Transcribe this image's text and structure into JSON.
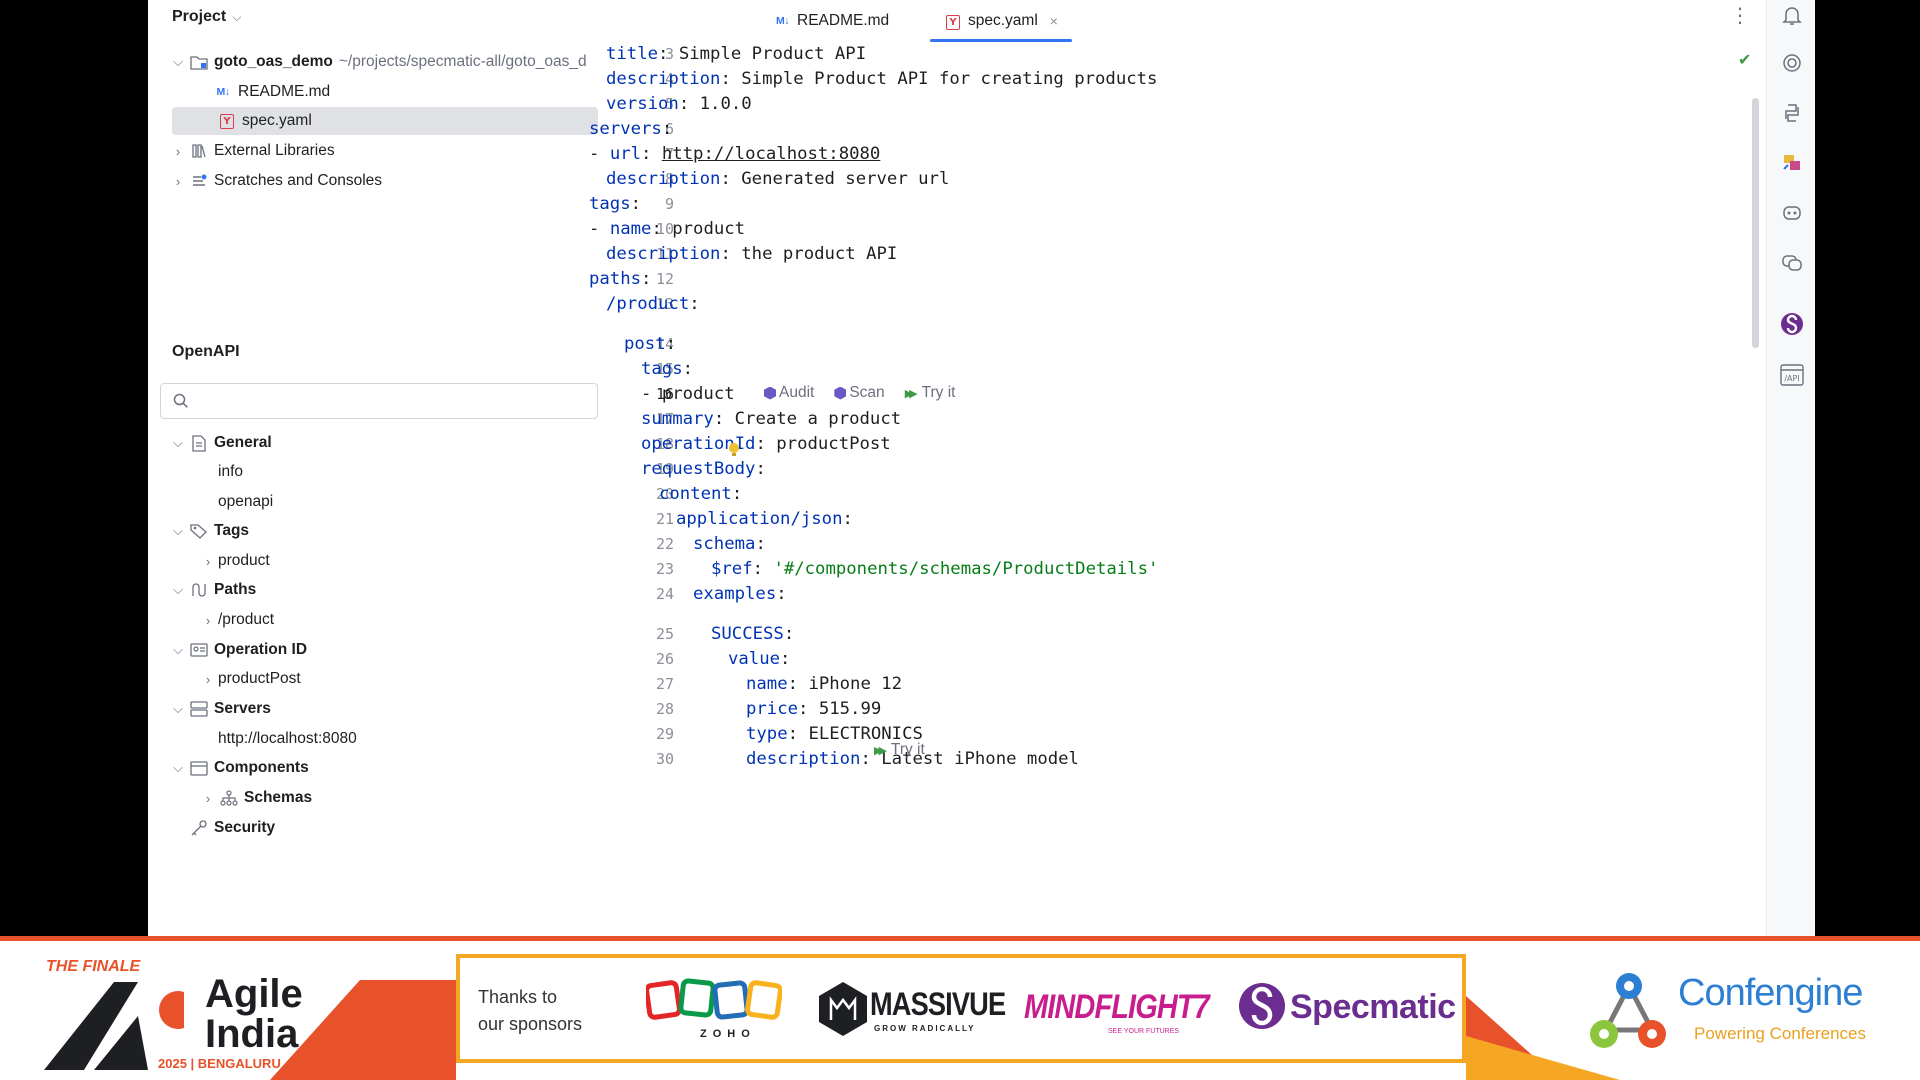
{
  "project_panel": {
    "title": "Project",
    "root": {
      "name": "goto_oas_demo",
      "path": "~/projects/specmatic-all/goto_oas_d"
    },
    "files": [
      {
        "name": "README.md",
        "icon": "markdown-icon",
        "selected": false
      },
      {
        "name": "spec.yaml",
        "icon": "yaml-icon",
        "selected": true
      }
    ],
    "external_libraries": "External Libraries",
    "scratches": "Scratches and Consoles"
  },
  "openapi_panel": {
    "title": "OpenAPI",
    "search_placeholder": "",
    "tree": {
      "general": {
        "label": "General",
        "children": [
          "info",
          "openapi"
        ]
      },
      "tags": {
        "label": "Tags",
        "children": [
          "product"
        ]
      },
      "paths": {
        "label": "Paths",
        "children": [
          "/product"
        ]
      },
      "operation_id": {
        "label": "Operation ID",
        "children": [
          "productPost"
        ]
      },
      "servers": {
        "label": "Servers",
        "children": [
          "http://localhost:8080"
        ]
      },
      "components": {
        "label": "Components",
        "children": [
          "Schemas"
        ]
      },
      "security": {
        "label": "Security"
      }
    }
  },
  "editor": {
    "tabs": [
      {
        "label": "README.md",
        "icon": "markdown-icon",
        "active": false
      },
      {
        "label": "spec.yaml",
        "icon": "yaml-icon",
        "active": true,
        "close": "×"
      }
    ],
    "current_line": 16,
    "lines": [
      {
        "n": "3",
        "key": "title",
        "val": "Simple Product API"
      },
      {
        "n": "4",
        "key": "description",
        "val": "Simple Product API for creating products"
      },
      {
        "n": "5",
        "key": "version",
        "val": "1.0.0"
      },
      {
        "n": "6",
        "key": "servers"
      },
      {
        "n": "7",
        "key": "url",
        "val": "http://localhost:8080",
        "dash": "- "
      },
      {
        "n": "8",
        "key": "description",
        "val": "Generated server url"
      },
      {
        "n": "9",
        "key": "tags"
      },
      {
        "n": "10",
        "key": "name",
        "val": "product",
        "dash": "- "
      },
      {
        "n": "11",
        "key": "description",
        "val": "the product API"
      },
      {
        "n": "12",
        "key": "paths"
      },
      {
        "n": "13",
        "key": "/product"
      },
      {
        "n": "14",
        "key": "post"
      },
      {
        "n": "15",
        "key": "tags"
      },
      {
        "n": "16",
        "val": "product",
        "dash": "- "
      },
      {
        "n": "17",
        "key": "summary",
        "val": "Create a product"
      },
      {
        "n": "18",
        "key": "operationId",
        "val": "productPost"
      },
      {
        "n": "19",
        "key": "requestBody"
      },
      {
        "n": "20",
        "key": "content"
      },
      {
        "n": "21",
        "key": "application/json"
      },
      {
        "n": "22",
        "key": "schema"
      },
      {
        "n": "23",
        "key": "$ref",
        "val": "'#/components/schemas/ProductDetails'"
      },
      {
        "n": "24",
        "key": "examples"
      },
      {
        "n": "25",
        "key": "SUCCESS"
      },
      {
        "n": "26",
        "key": "value"
      },
      {
        "n": "27",
        "key": "name",
        "val": "iPhone 12"
      },
      {
        "n": "28",
        "key": "price",
        "val": "515.99"
      },
      {
        "n": "29",
        "key": "type",
        "val": "ELECTRONICS"
      },
      {
        "n": "30",
        "key": "description",
        "val": "Latest iPhone model"
      }
    ],
    "code_lens_path": {
      "audit": "Audit",
      "scan": "Scan",
      "try_it": "Try it"
    },
    "code_lens_examples": {
      "try_it": "Try it"
    }
  },
  "right_toolbar": {
    "icons": [
      "notifications-icon",
      "ai-assistant-icon",
      "python-console-icon",
      "database-icon",
      "copilot-icon",
      "copilot-chat-icon",
      "specmatic-icon",
      "api-icon"
    ],
    "api_label": "/API"
  },
  "banner": {
    "finale": "THE FINALE",
    "agile": "Agile",
    "india": "India",
    "event_year": "2025 | BENGALURU",
    "thanks": "Thanks to\nour sponsors",
    "sponsors": {
      "zoho": "ZOHO",
      "massivue": "MASSIVUE",
      "massivue_tag": "GROW RADICALLY",
      "mindflight": "MINDFLIGHT7",
      "mindflight_tag": "SEE YOUR FUTURES",
      "specmatic": "Specmatic"
    },
    "confengine": "Confengine",
    "confengine_tag": "Powering Conferences",
    "colors": {
      "orange": "#f5a623",
      "red": "#e8522a",
      "specmatic": "#6b2d90",
      "mindflight": "#c81d8c",
      "confengine": "#2c7fd3"
    }
  }
}
